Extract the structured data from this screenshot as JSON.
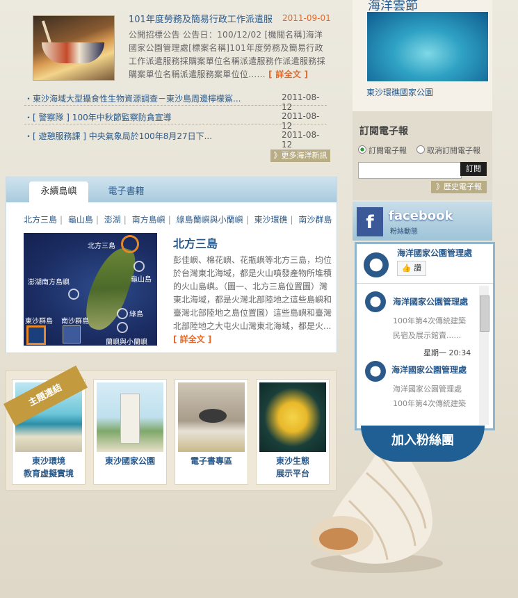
{
  "news": {
    "featured": {
      "title": "101年度勞務及簡易行政工作派遣服",
      "date": "2011-09-01",
      "summary": "公開招標公告 公告日：100/12/02 [機關名稱]海洋國家公園管理處[標案名稱]101年度勞務及簡易行政工作派遣服務採購案單位名稱派遣服務作派遣服務採購案單位名稱派遣服務案單位位......",
      "more": "[ 詳全文 ]"
    },
    "items": [
      {
        "title": "・東沙海域大型攝食性生物資源調查－東沙島周邊檸檬鯊...",
        "date": "2011-08-12"
      },
      {
        "title": "・[ 警察隊 ] 100年中秋節監察防貪宣導",
        "date": "2011-08-12"
      },
      {
        "title": "・[ 遊憩服務課 ] 中央氣象局於100年8月27日下...",
        "date": "2011-08-12"
      }
    ],
    "more_button": "》更多海洋新訊"
  },
  "islands": {
    "tabs": [
      "永續島嶼",
      "電子書籍"
    ],
    "links": [
      "北方三島",
      "龜山島",
      "澎湖",
      "南方島嶼",
      "綠島蘭嶼與小蘭嶼",
      "東沙環礁",
      "南沙群島"
    ],
    "map_labels": [
      "北方三島",
      "龜山島",
      "澎湖南方島嶼",
      "綠島",
      "蘭嶼與小蘭嶼",
      "東沙群島",
      "南沙群島"
    ],
    "title": "北方三島",
    "description": "彭佳嶼、棉花嶼、花瓶嶼等北方三島，均位於台灣東北海域，都是火山噴發產物所堆積的火山島嶼。（圖一、北方三島位置圖）灣東北海域，都是火灣北部陸地之這些島嶼和臺灣北部陸地之島位置圖）這些島嶼和臺灣北部陸地之大屯火山灣東北海域，都是火...",
    "more": "[ 詳全文 ]"
  },
  "theme_links": {
    "ribbon": "主題連結",
    "cards": [
      {
        "label1": "東沙環境",
        "label2": "教育虛擬實境"
      },
      {
        "label1": "東沙國家公園",
        "label2": ""
      },
      {
        "label1": "電子書專區",
        "label2": ""
      },
      {
        "label1": "東沙生態",
        "label2": "展示平台"
      }
    ]
  },
  "sidebar": {
    "top_title": "海洋雲節",
    "photo_caption": "東沙環礁國家公園",
    "subscribe": {
      "title": "訂閱電子報",
      "opt_subscribe": "訂閱電子報",
      "opt_unsubscribe": "取消訂閱電子報",
      "button": "訂閱",
      "history": "》歷史電子報"
    },
    "facebook": {
      "logo": "f",
      "word": "facebook",
      "sub": "粉絲動態",
      "page_name": "海洋國家公園管理處",
      "like": "讚",
      "posts": [
        {
          "name": "海洋國家公園管理處",
          "text1": "100年第4次傳統建築",
          "text2": "民宿及展示館賣......"
        },
        {
          "name": "海洋國家公園管理處",
          "text1": "海洋國家公園管理處",
          "text2": "100年第4次傳統建築"
        }
      ],
      "timestamp": "星期一 20:34",
      "join": "加入粉絲團"
    }
  },
  "colors": {
    "link": "#2b5a8a",
    "accent_orange": "#e06a2a",
    "fb_blue": "#1f5f93"
  }
}
